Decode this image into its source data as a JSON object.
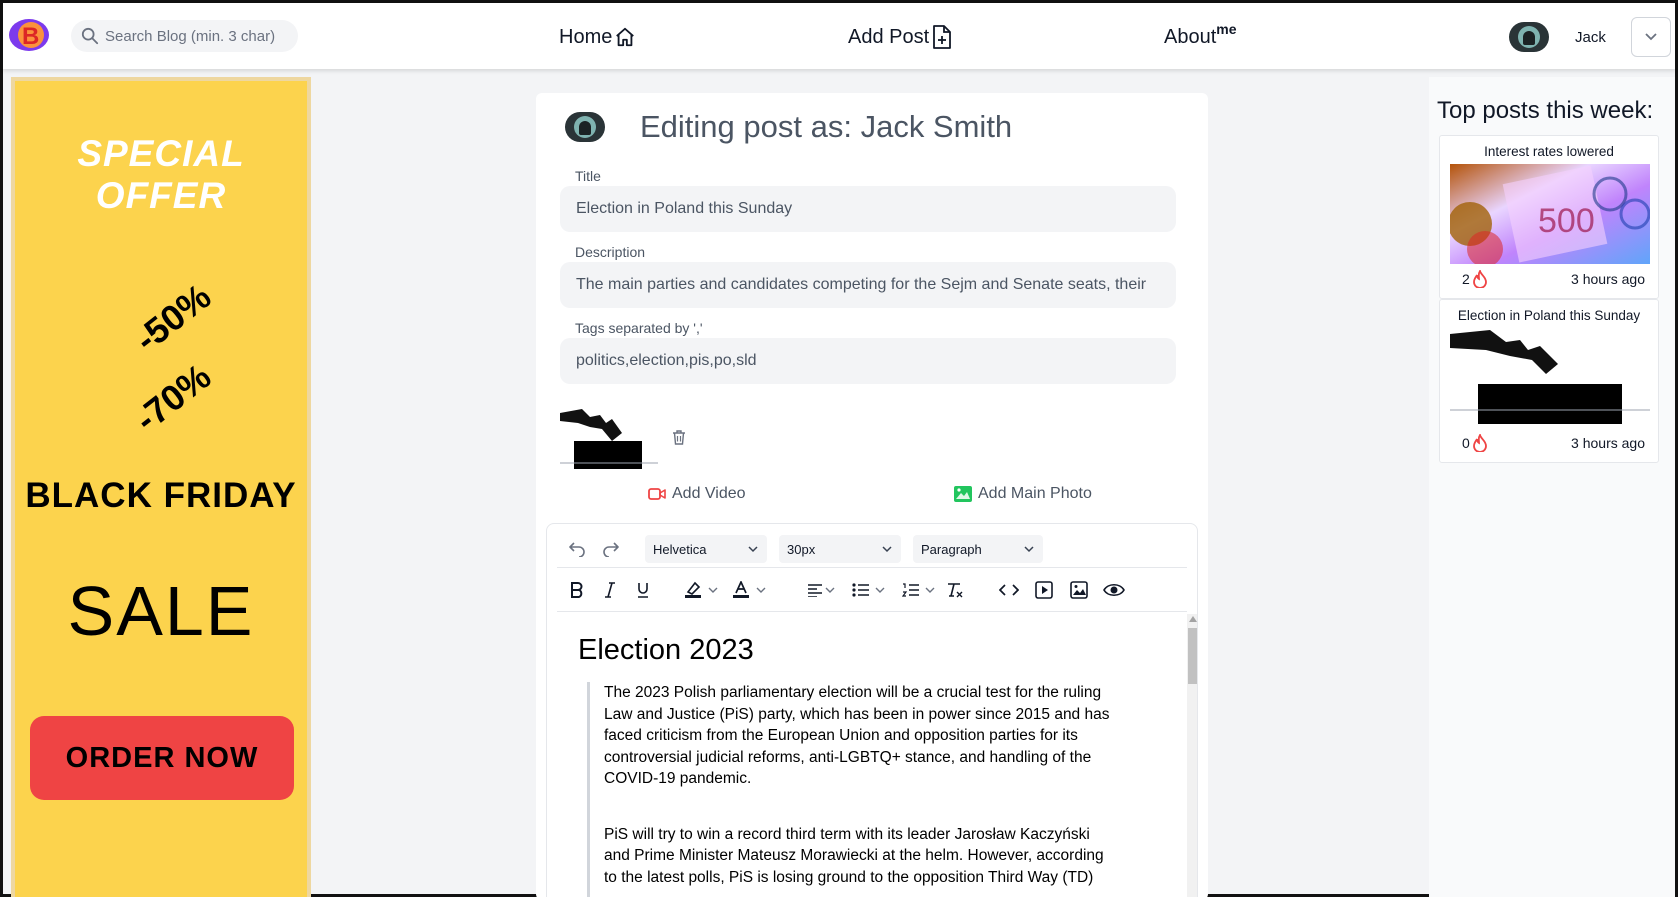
{
  "header": {
    "logo_letter": "B",
    "search_placeholder": "Search Blog (min. 3 char)",
    "nav": {
      "home": "Home",
      "add_post": "Add Post",
      "about": "About",
      "about_sup": "me"
    },
    "user_name": "Jack"
  },
  "ad": {
    "special_offer": "SPECIAL OFFER",
    "discount_1": "-50%",
    "discount_2": "-70%",
    "black_friday": "BLACK FRIDAY",
    "sale": "SALE",
    "order_button": "ORDER NOW",
    "background_color": "#fcd34d",
    "button_color": "#ef4444"
  },
  "editor_form": {
    "heading": "Editing post as: Jack Smith",
    "title_label": "Title",
    "title_value": "Election in Poland this Sunday",
    "description_label": "Description",
    "description_value": "The main parties and candidates competing for the Sejm and Senate seats, their",
    "tags_label": "Tags separated by ','",
    "tags_value": "politics,election,pis,po,sld",
    "add_video": "Add Video",
    "add_main_photo": "Add Main Photo"
  },
  "toolbar": {
    "font_family": "Helvetica",
    "font_size": "30px",
    "block_type": "Paragraph"
  },
  "document": {
    "heading": "Election 2023",
    "paragraph_1": "  The 2023 Polish parliamentary election will be a crucial test for the ruling Law and Justice (PiS) party, which has been in power since 2015 and has faced criticism from the European Union and opposition parties for its controversial judicial reforms, anti-LGBTQ+ stance, and handling of the COVID-19 pandemic.",
    "paragraph_2": " PiS will try to win a record third term with its leader Jarosław Kaczyński and Prime Minister Mateusz Morawiecki at the helm. However, according to the latest polls, PiS is losing ground to the opposition Third Way (TD)"
  },
  "sidebar": {
    "title": "Top posts this week:",
    "posts": [
      {
        "title": "Interest rates lowered",
        "likes": "2",
        "time": "3 hours ago"
      },
      {
        "title": "Election in Poland this Sunday",
        "likes": "0",
        "time": "3 hours ago"
      }
    ]
  }
}
